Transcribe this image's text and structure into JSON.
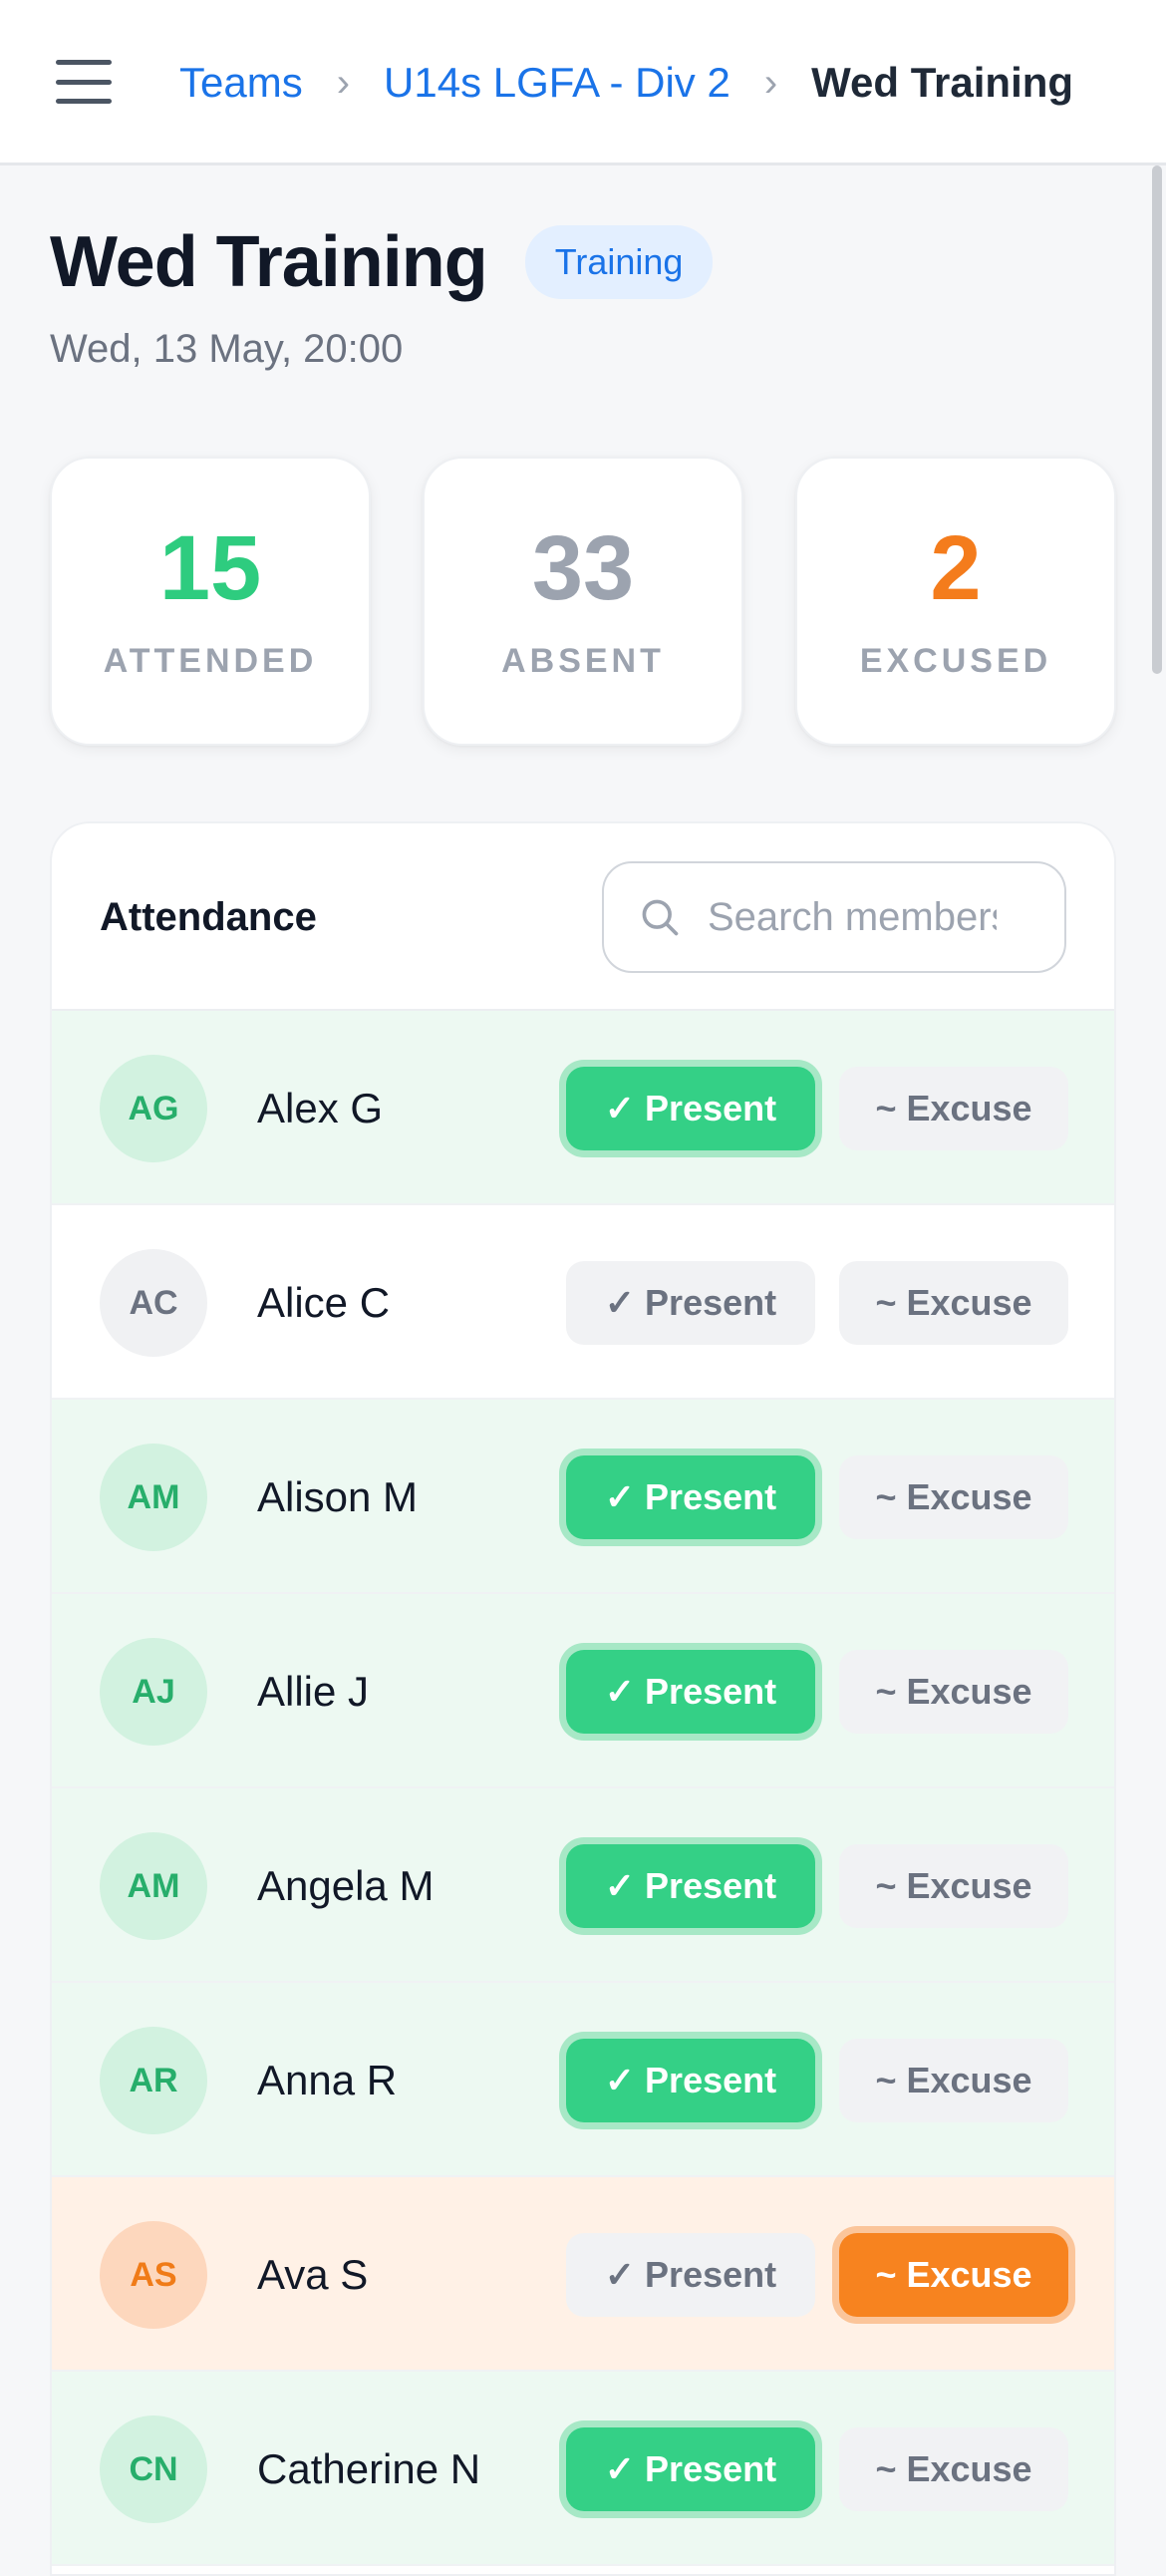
{
  "breadcrumb": {
    "teams": "Teams",
    "team": "U14s LGFA - Div 2",
    "current": "Wed Training",
    "separator": "›"
  },
  "event": {
    "title": "Wed Training",
    "type": "Training",
    "datetime": "Wed, 13 May, 20:00"
  },
  "stats": {
    "attended": {
      "value": "15",
      "label": "ATTENDED",
      "color": "#2ecc7f"
    },
    "absent": {
      "value": "33",
      "label": "ABSENT",
      "color": "#9ca3af"
    },
    "excused": {
      "value": "2",
      "label": "EXCUSED",
      "color": "#f47c1c"
    }
  },
  "attendance": {
    "title": "Attendance",
    "search_placeholder": "Search members",
    "present_label": "✓ Present",
    "excuse_label": "~ Excuse",
    "members": [
      {
        "initials": "AG",
        "name": "Alex G",
        "status": "present"
      },
      {
        "initials": "AC",
        "name": "Alice C",
        "status": "absent"
      },
      {
        "initials": "AM",
        "name": "Alison M",
        "status": "present"
      },
      {
        "initials": "AJ",
        "name": "Allie J",
        "status": "present"
      },
      {
        "initials": "AM",
        "name": "Angela M",
        "status": "present"
      },
      {
        "initials": "AR",
        "name": "Anna R",
        "status": "present"
      },
      {
        "initials": "AS",
        "name": "Ava S",
        "status": "excused"
      },
      {
        "initials": "CN",
        "name": "Catherine N",
        "status": "present"
      }
    ]
  },
  "icons": {
    "menu": "hamburger-menu-icon",
    "search": "search-icon"
  }
}
